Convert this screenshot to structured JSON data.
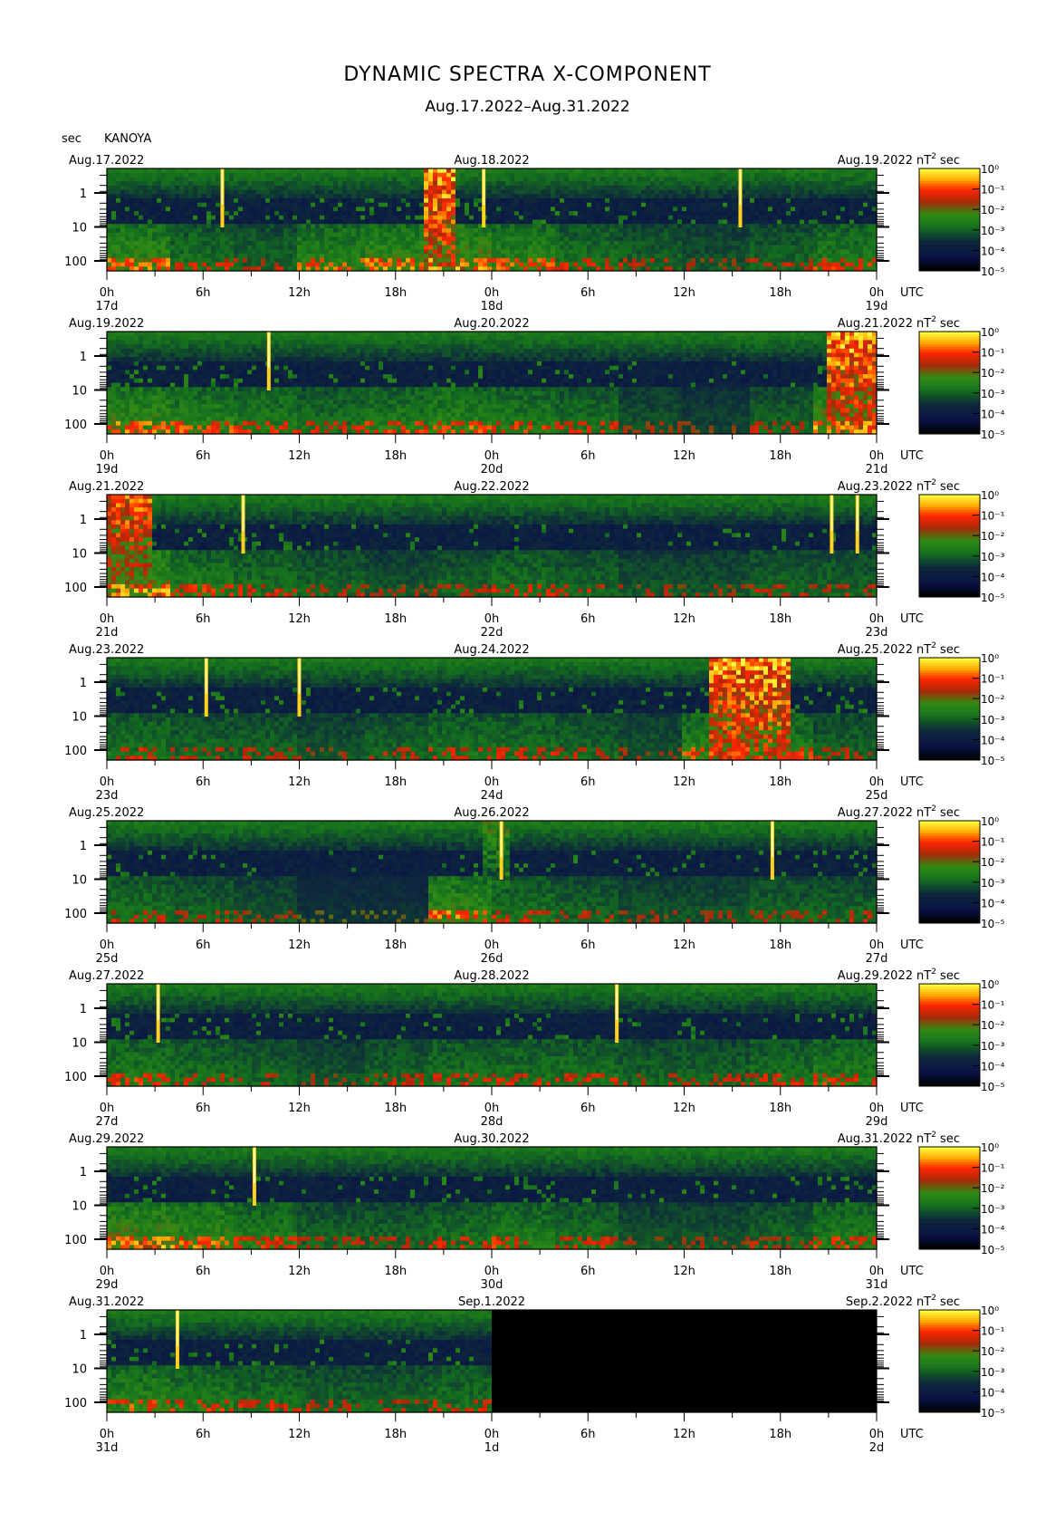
{
  "title": "DYNAMIC SPECTRA X-COMPONENT",
  "subtitle": "Aug.17.2022–Aug.31.2022",
  "station": "KANOYA",
  "y_unit": "sec",
  "unit_label": "nT",
  "unit_exp": "2",
  "unit_suffix": "sec",
  "utc_label": "UTC",
  "chart_data": {
    "type": "heatmap",
    "title": "DYNAMIC SPECTRA X-COMPONENT",
    "ylabel": "sec",
    "y_scale": "log",
    "y_ticks": [
      "1",
      "10",
      "100"
    ],
    "x_ticks": [
      "0h",
      "6h",
      "12h",
      "18h",
      "0h",
      "6h",
      "12h",
      "18h",
      "0h"
    ],
    "colorbar": {
      "label": "nT² sec",
      "ticks": [
        "10⁰",
        "10⁻¹",
        "10⁻²",
        "10⁻³",
        "10⁻⁴",
        "10⁻⁵"
      ],
      "colors": [
        "#fffb3b",
        "#ffb300",
        "#ff2a00",
        "#c03010",
        "#1f8a1f",
        "#0a3a1a",
        "#0c1450",
        "#000000"
      ]
    },
    "panels": [
      {
        "start_label": "Aug.17.2022",
        "mid_label": "Aug.18.2022",
        "end_label": "Aug.19.2022",
        "day_labels": [
          "17d",
          "18d",
          "19d"
        ],
        "spikes": [
          7.2,
          39.5,
          23.5
        ],
        "bursts": [
          [
            19.8,
            21.8,
            1.0
          ]
        ],
        "activity": [
          0.5,
          0.35,
          0.3,
          0.45,
          0.5,
          0.55,
          0.45,
          0.35,
          0.3,
          0.25,
          0.3,
          0.4
        ]
      },
      {
        "start_label": "Aug.19.2022",
        "mid_label": "Aug.20.2022",
        "end_label": "Aug.21.2022",
        "day_labels": [
          "19d",
          "20d",
          "21d"
        ],
        "spikes": [
          10.1
        ],
        "bursts": [
          [
            44.8,
            47.9,
            1.0
          ]
        ],
        "activity": [
          0.5,
          0.45,
          0.4,
          0.35,
          0.4,
          0.45,
          0.4,
          0.35,
          0.25,
          0.2,
          0.3,
          0.55
        ]
      },
      {
        "start_label": "Aug.21.2022",
        "mid_label": "Aug.22.2022",
        "end_label": "Aug.23.2022",
        "day_labels": [
          "21d",
          "22d",
          "23d"
        ],
        "spikes": [
          8.5,
          45.2,
          46.8
        ],
        "bursts": [
          [
            0.0,
            2.8,
            0.9
          ]
        ],
        "activity": [
          0.55,
          0.4,
          0.35,
          0.3,
          0.25,
          0.3,
          0.35,
          0.3,
          0.25,
          0.25,
          0.3,
          0.3
        ]
      },
      {
        "start_label": "Aug.23.2022",
        "mid_label": "Aug.24.2022",
        "end_label": "Aug.25.2022",
        "day_labels": [
          "23d",
          "24d",
          "25d"
        ],
        "spikes": [
          6.2,
          12.0
        ],
        "bursts": [
          [
            37.5,
            42.5,
            1.0
          ]
        ],
        "activity": [
          0.35,
          0.3,
          0.3,
          0.25,
          0.3,
          0.35,
          0.35,
          0.3,
          0.25,
          0.45,
          0.4,
          0.3
        ]
      },
      {
        "start_label": "Aug.25.2022",
        "mid_label": "Aug.26.2022",
        "end_label": "Aug.27.2022",
        "day_labels": [
          "25d",
          "26d",
          "27d"
        ],
        "spikes": [
          24.6,
          41.5
        ],
        "bursts": [
          [
            23.4,
            25.0,
            0.6
          ]
        ],
        "activity": [
          0.35,
          0.3,
          0.25,
          0.15,
          0.15,
          0.5,
          0.35,
          0.3,
          0.25,
          0.25,
          0.3,
          0.3
        ]
      },
      {
        "start_label": "Aug.27.2022",
        "mid_label": "Aug.28.2022",
        "end_label": "Aug.29.2022",
        "day_labels": [
          "27d",
          "28d",
          "29d"
        ],
        "spikes": [
          3.2,
          31.8
        ],
        "bursts": [],
        "activity": [
          0.4,
          0.35,
          0.3,
          0.25,
          0.3,
          0.35,
          0.35,
          0.35,
          0.3,
          0.3,
          0.35,
          0.4
        ]
      },
      {
        "start_label": "Aug.29.2022",
        "mid_label": "Aug.30.2022",
        "end_label": "Aug.31.2022",
        "day_labels": [
          "29d",
          "30d",
          "31d"
        ],
        "spikes": [
          9.2
        ],
        "bursts": [],
        "activity": [
          0.55,
          0.5,
          0.4,
          0.3,
          0.3,
          0.35,
          0.4,
          0.35,
          0.25,
          0.25,
          0.3,
          0.4
        ]
      },
      {
        "start_label": "Aug.31.2022",
        "mid_label": "Sep.1.2022",
        "end_label": "Sep.2.2022",
        "day_labels": [
          "31d",
          "1d",
          "2d"
        ],
        "spikes": [
          4.4
        ],
        "bursts": [],
        "activity": [
          0.45,
          0.4,
          0.35,
          0.3,
          0.3,
          0.35
        ],
        "data_until_hour": 24
      }
    ]
  }
}
